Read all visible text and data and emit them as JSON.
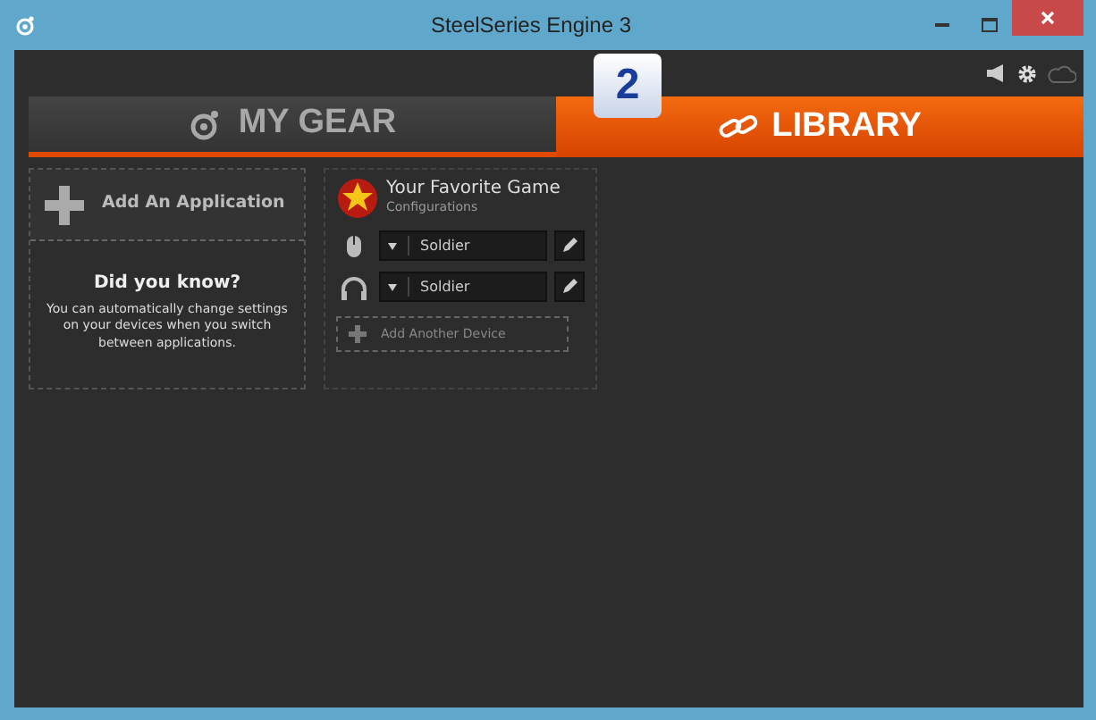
{
  "window": {
    "title": "SteelSeries Engine 3"
  },
  "step_badge": "2",
  "tabs": [
    {
      "label": "MY GEAR",
      "selected": false,
      "kind": "gear"
    },
    {
      "label": "LIBRARY",
      "selected": true,
      "kind": "library"
    }
  ],
  "add_application": {
    "label": "Add An Application"
  },
  "tip": {
    "title": "Did you know?",
    "text": "You can automatically change settings on your devices when you switch between applications."
  },
  "game": {
    "title": "Your Favorite Game",
    "subtitle": "Configurations",
    "devices": [
      {
        "kind": "mouse",
        "config": "Soldier"
      },
      {
        "kind": "headset",
        "config": "Soldier"
      }
    ],
    "add_device": "Add Another Device"
  }
}
